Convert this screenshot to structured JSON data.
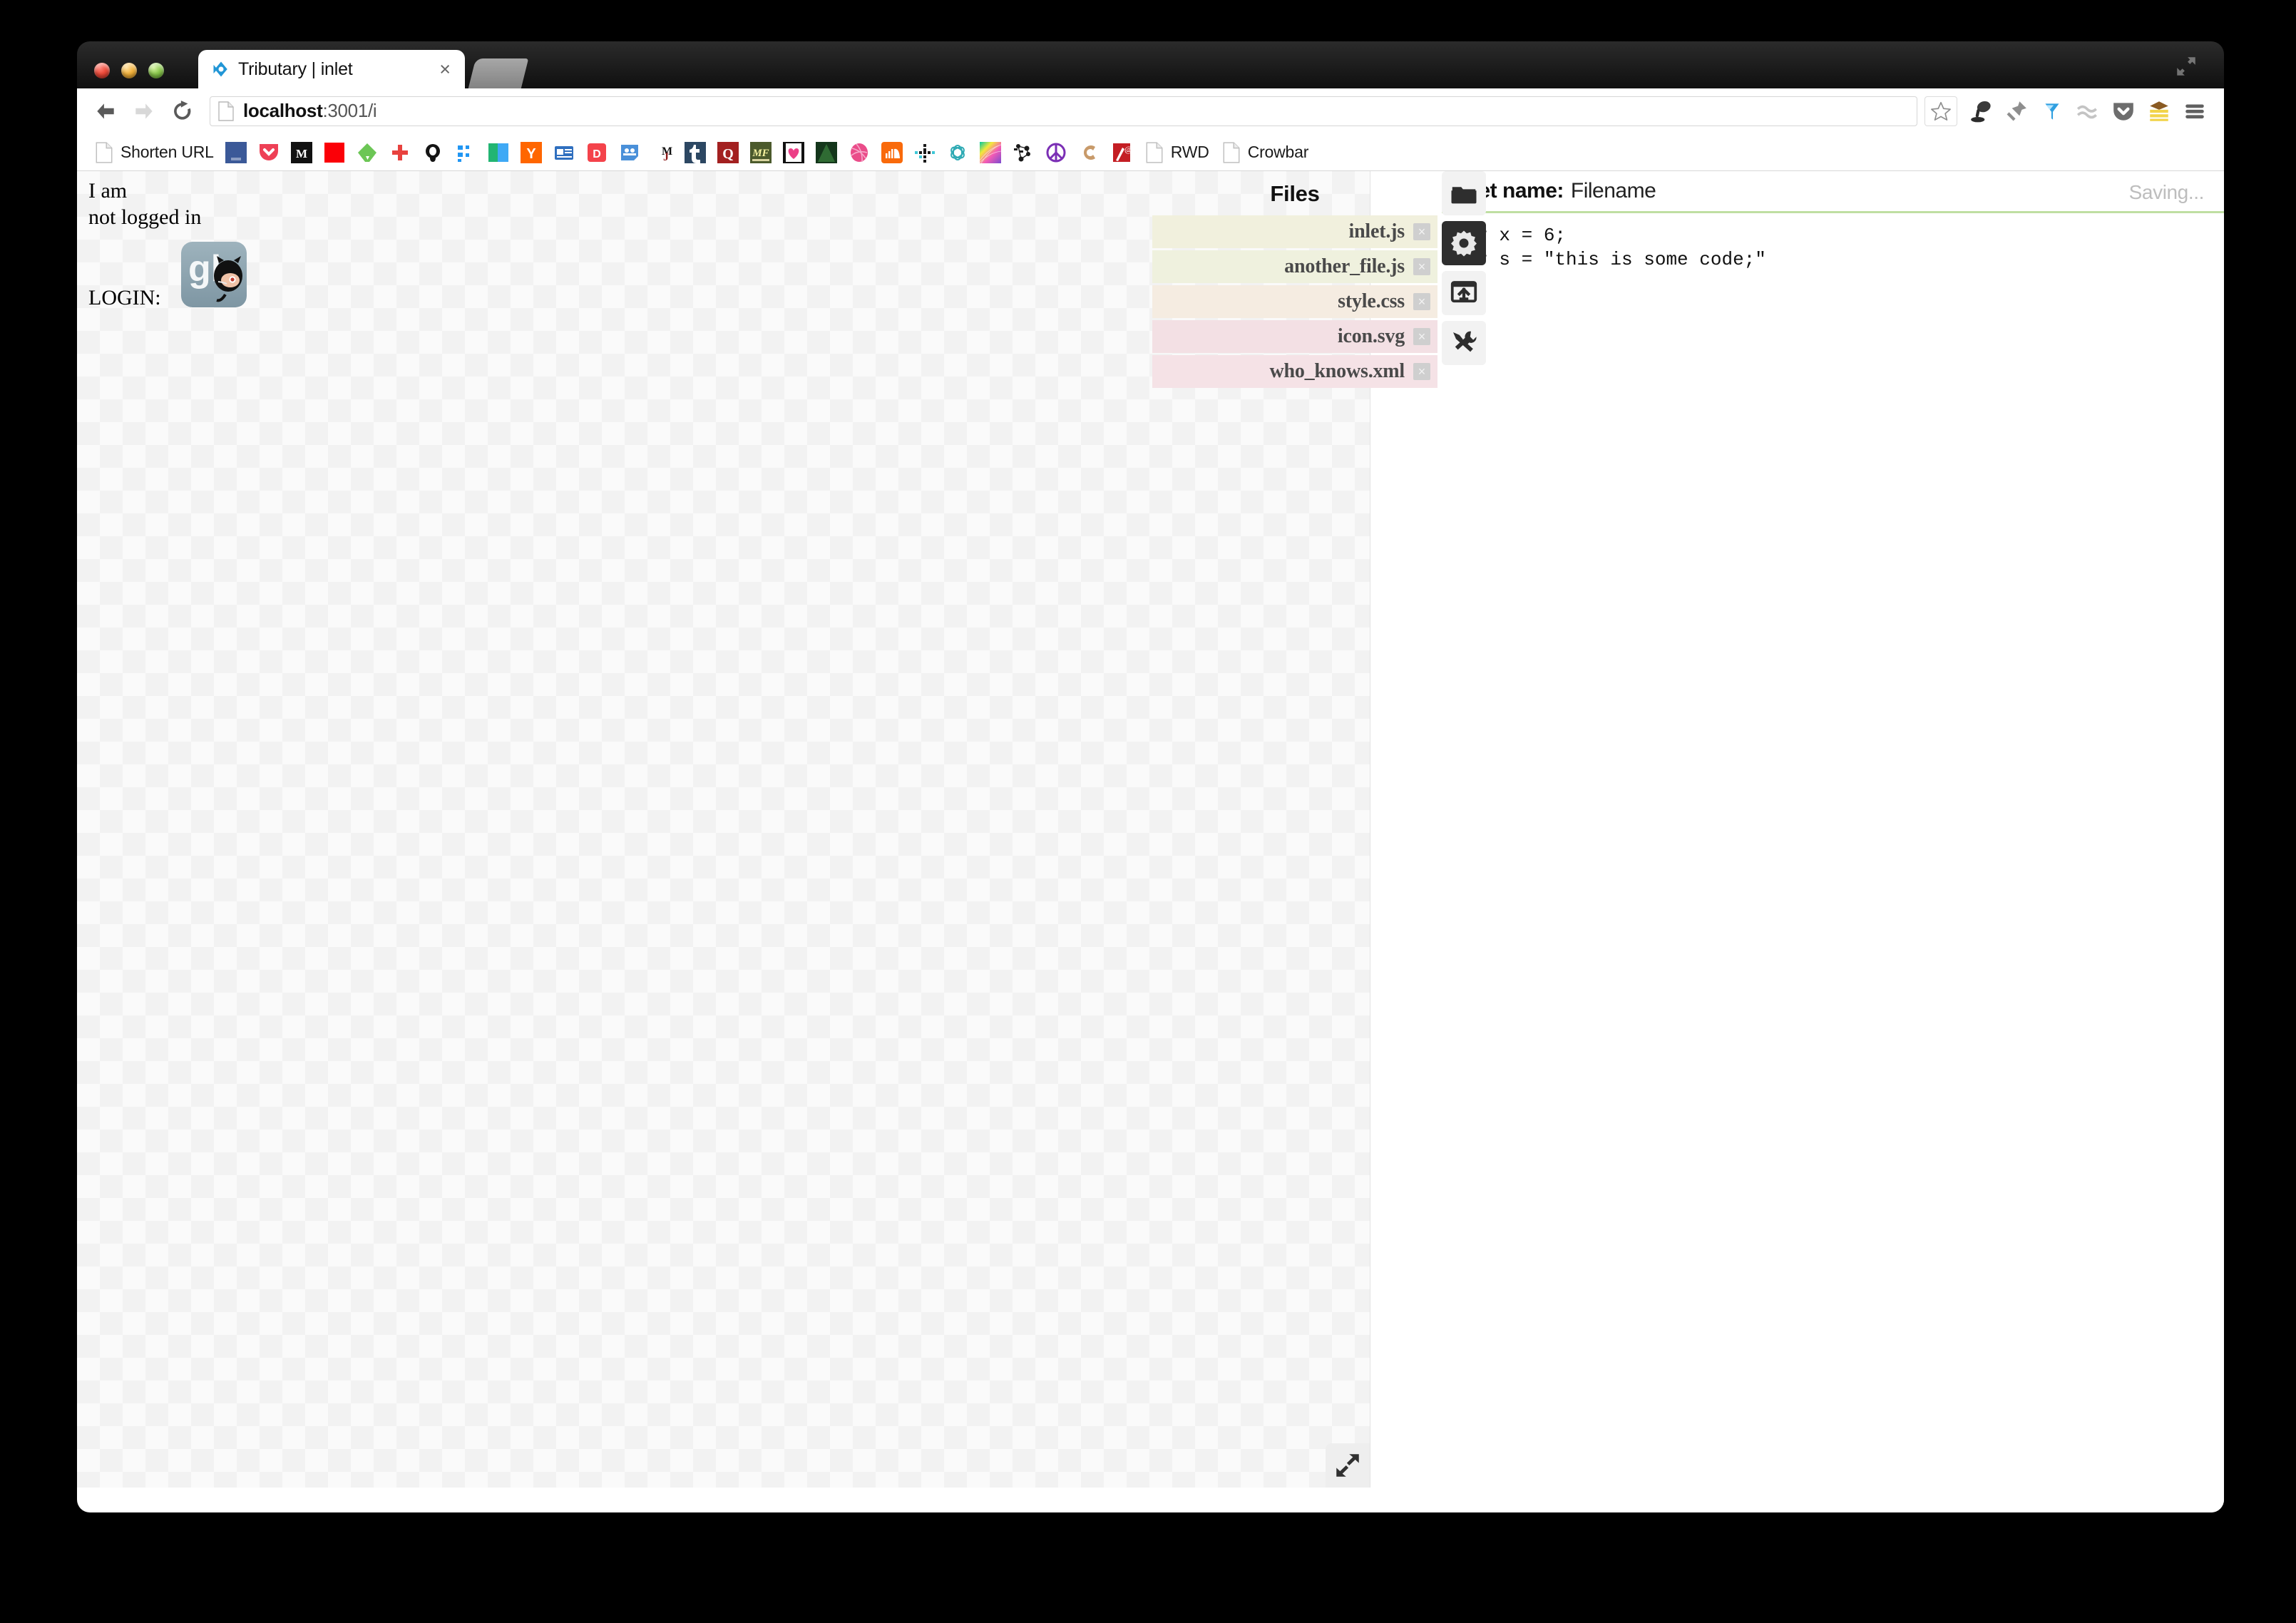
{
  "window": {
    "traffic_lights": [
      "close",
      "minimize",
      "zoom"
    ],
    "expand_icon": "fullscreen-expand-icon"
  },
  "browser": {
    "tab": {
      "title": "Tributary | inlet",
      "favicon": "tributary-favicon",
      "close_label": "×"
    },
    "nav": {
      "back": "back-arrow",
      "forward": "forward-arrow",
      "reload": "reload-arrow"
    },
    "omnibox": {
      "host": "localhost",
      "path": ":3001/i",
      "page_icon": "page-document-icon"
    },
    "star": "bookmark-star-icon",
    "extensions": [
      {
        "name": "lamp-icon"
      },
      {
        "name": "pushpin-icon"
      },
      {
        "name": "funnel-icon"
      },
      {
        "name": "wave-icon"
      },
      {
        "name": "pocket-icon"
      },
      {
        "name": "stack-icon"
      },
      {
        "name": "chrome-menu-icon"
      }
    ],
    "bookmarks": [
      {
        "label": "Shorten URL",
        "icon": "page-document-icon",
        "color": "#fefefe",
        "type": "page"
      },
      {
        "label": "",
        "icon": "facebook-icon",
        "color": "#3b5998",
        "type": "square"
      },
      {
        "label": "",
        "icon": "pocket-icon",
        "color": "#ee4056",
        "type": "square"
      },
      {
        "label": "",
        "icon": "medium-icon",
        "color": "#111111",
        "type": "square"
      },
      {
        "label": "",
        "icon": "red-square-icon",
        "color": "#fb0007",
        "type": "square"
      },
      {
        "label": "",
        "icon": "feedly-icon",
        "color": "#6cc655",
        "type": "square"
      },
      {
        "label": "",
        "icon": "redcross-plus-icon",
        "color": "#e8423f",
        "type": "square"
      },
      {
        "label": "",
        "icon": "github-icon",
        "color": "#141414",
        "type": "square"
      },
      {
        "label": "",
        "icon": "dots-icon",
        "color": "#2196f3",
        "type": "square"
      },
      {
        "label": "",
        "icon": "teal-blue-icon",
        "color": "#22b573",
        "type": "square"
      },
      {
        "label": "",
        "icon": "hackernews-icon",
        "color": "#ff6600",
        "type": "square"
      },
      {
        "label": "",
        "icon": "news-icon",
        "color": "#2f6fbf",
        "type": "square"
      },
      {
        "label": "",
        "icon": "designernews-icon",
        "color": "#f4434b",
        "type": "square"
      },
      {
        "label": "",
        "icon": "slideshare-icon",
        "color": "#4a90d9",
        "type": "square"
      },
      {
        "label": "",
        "icon": "mj-icon",
        "color": "#ffffff",
        "type": "square"
      },
      {
        "label": "",
        "icon": "tumblr-icon",
        "color": "#2c4762",
        "type": "square"
      },
      {
        "label": "",
        "icon": "quora-icon",
        "color": "#a32020",
        "type": "square"
      },
      {
        "label": "",
        "icon": "mf-icon",
        "color": "#4b5a2c",
        "type": "square"
      },
      {
        "label": "",
        "icon": "heart-icon",
        "color": "#ffffff",
        "type": "square"
      },
      {
        "label": "",
        "icon": "mountain-icon",
        "color": "#14361b",
        "type": "square"
      },
      {
        "label": "",
        "icon": "dribbble-icon",
        "color": "#ea4c89",
        "type": "square"
      },
      {
        "label": "",
        "icon": "soundcloud-icon",
        "color": "#f96a0b",
        "type": "square"
      },
      {
        "label": "",
        "icon": "grid-dots-icon",
        "color": "#ffffff",
        "type": "square"
      },
      {
        "label": "",
        "icon": "knot-icon",
        "color": "#ffffff",
        "type": "square"
      },
      {
        "label": "",
        "icon": "rainbow-icon",
        "color": "#a050d0",
        "type": "square"
      },
      {
        "label": "",
        "icon": "node-graph-icon",
        "color": "#ffffff",
        "type": "square"
      },
      {
        "label": "",
        "icon": "peace-icon",
        "color": "#7b2fb5",
        "type": "square"
      },
      {
        "label": "",
        "icon": "c-icon",
        "color": "#c89a6a",
        "type": "square"
      },
      {
        "label": "",
        "icon": "at-pen-icon",
        "color": "#c41e24",
        "type": "square"
      },
      {
        "label": "RWD",
        "icon": "page-document-icon",
        "color": "#fefefe",
        "type": "page"
      },
      {
        "label": "Crowbar",
        "icon": "page-document-icon",
        "color": "#fefefe",
        "type": "page"
      }
    ]
  },
  "page": {
    "preview": {
      "lines": [
        "I am",
        "not logged in"
      ],
      "login_label": "LOGIN:",
      "github_icon": "github-login-icon",
      "resize_handle": "resize-expand-icon"
    },
    "files_panel": {
      "title": "Files",
      "delete_glyph": "×",
      "files": [
        {
          "name": "inlet.js",
          "color": "#f1f0dd"
        },
        {
          "name": "another_file.js",
          "color": "#eff1de"
        },
        {
          "name": "style.css",
          "color": "#f5ece1"
        },
        {
          "name": "icon.svg",
          "color": "#f3e0e4"
        },
        {
          "name": "who_knows.xml",
          "color": "#f5e2e6"
        }
      ]
    },
    "rail": [
      {
        "name": "folder-icon",
        "active": false
      },
      {
        "name": "gear-icon",
        "active": true
      },
      {
        "name": "deploy-icon",
        "active": false
      },
      {
        "name": "tools-icon",
        "active": false
      }
    ],
    "editor": {
      "label": "Inlet name:",
      "filename": "Filename",
      "status": "Saving...",
      "accent_color": "#bfdfa2",
      "code": "var x = 6;\nvar s = \"this is some code;\""
    }
  }
}
